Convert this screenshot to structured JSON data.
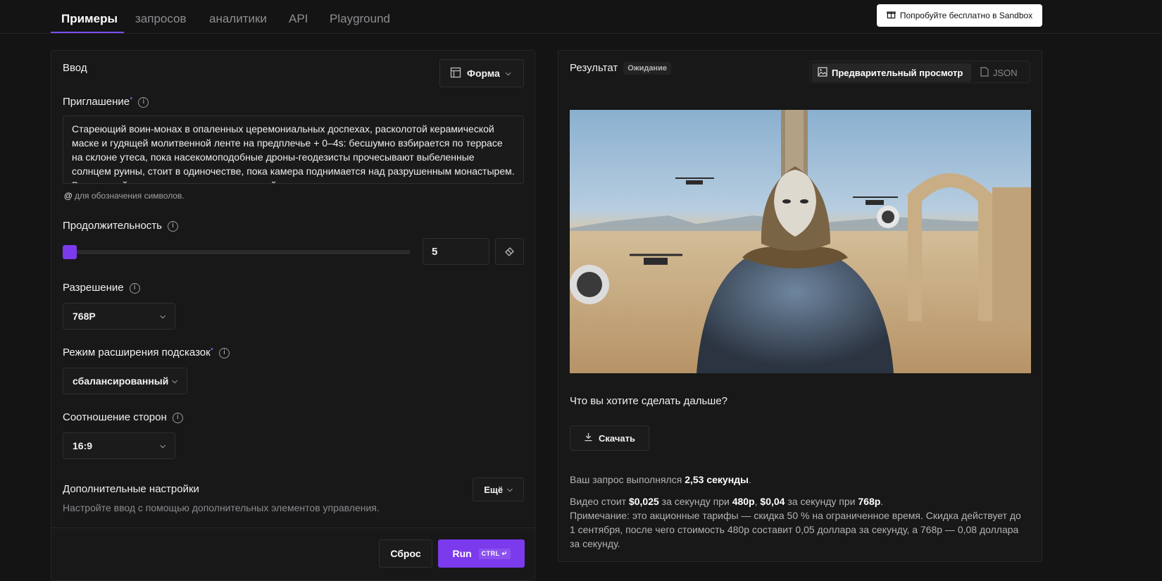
{
  "nav": {
    "tabs": [
      {
        "label": "Примеры",
        "active": true
      },
      {
        "label": "запросов"
      },
      {
        "label": "аналитики"
      },
      {
        "label": "API"
      },
      {
        "label": "Playground"
      }
    ],
    "sandbox_button": "Попробуйте бесплатно в Sandbox"
  },
  "input_panel": {
    "title": "Ввод",
    "view_mode": "Форма",
    "prompt": {
      "label": "Приглашение",
      "required_mark": "*",
      "value": "Стареющий воин-монах в опаленных церемониальных доспехах, расколотой керамической маске и гудящей молитвенной ленте на предплечье + 0–4s: бесшумно взбирается по террасе на склоне утеса, пока насекомоподобные дроны-геодезисты прочесывают выбеленные солнцем руины, стоит в одиночестве, пока камера поднимается над разрушенным монастырем. Выжженный солнцем постапокалиптический научно",
      "hint_symbol": "@",
      "hint": "для обозначения символов."
    },
    "duration": {
      "label": "Продолжительность",
      "value": "5",
      "slider_fraction": 0.0
    },
    "resolution": {
      "label": "Разрешение",
      "value": "768P"
    },
    "prompt_expansion": {
      "label": "Режим расширения подсказок",
      "required_mark": "*",
      "value": "сбалансированный"
    },
    "aspect_ratio": {
      "label": "Соотношение сторон",
      "value": "16:9"
    },
    "advanced": {
      "title": "Дополнительные настройки",
      "more_label": "Ещё",
      "description": "Настройте ввод с помощью дополнительных элементов управления."
    },
    "reset_label": "Сброс",
    "run_label": "Run",
    "run_shortcut": "CTRL ↵"
  },
  "result_panel": {
    "title": "Результат",
    "status": "Ожидание",
    "preview_tab": "Предварительный просмотр",
    "json_tab": "JSON",
    "next_question": "Что вы хотите сделать дальше?",
    "download_label": "Скачать",
    "timing_prefix": "Ваш запрос выполнялся",
    "timing_value": "2,53 секунды",
    "timing_suffix": ".",
    "price_1": "Видео стоит",
    "price_1_value": "$0,025",
    "price_2": "за секунду при",
    "price_2_value": "480p",
    "price_3": ",",
    "price_3_value": "$0,04",
    "price_4": "за секунду при",
    "price_4_value": "768p",
    "price_5": ".",
    "note": "Примечание: это акционные тарифы — скидка 50 % на ограниченное время. Скидка действует до 1 сентября, после чего стоимость 480р составит 0,05 доллара за секунду, а 768р — 0,08 доллара за секунду."
  },
  "colors": {
    "accent": "#7c3aed",
    "background": "#141414",
    "panel": "#181818"
  },
  "icons": [
    "gift-icon",
    "form-layout-icon",
    "chevron-down-icon",
    "info-icon",
    "eraser-icon",
    "image-icon",
    "json-file-icon",
    "download-icon",
    "enter-key-icon"
  ]
}
